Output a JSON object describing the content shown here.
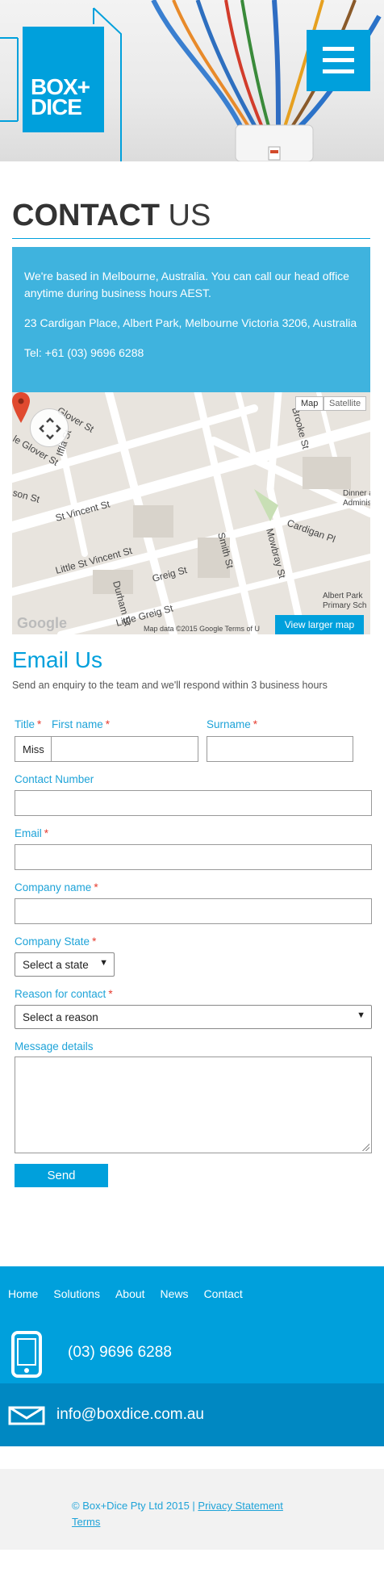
{
  "brand": {
    "logo_line1": "BOX+",
    "logo_line2": "DICE",
    "accent_color": "#00a0dc"
  },
  "header": {
    "menu_icon": "hamburger-icon"
  },
  "contact": {
    "title_bold": "CONTACT",
    "title_light": "US",
    "intro": "We're based in Melbourne, Australia. You can call our head office anytime during business hours AEST.",
    "address": "23 Cardigan Place, Albert Park, Melbourne Victoria 3206, Australia",
    "tel": "Tel: +61 (03) 9696 6288"
  },
  "map": {
    "toggle_map": "Map",
    "toggle_satellite": "Satellite",
    "larger_map": "View larger map",
    "attribution": "Map data ©2015 Google    Terms of U",
    "google_mark": "Google",
    "streets": [
      "Glover St",
      "Glover St",
      "Iffla St",
      "St Vincent St",
      "Little St Vincent St",
      "Durham St",
      "Greig St",
      "Little Greig St",
      "Smith St",
      "Mowbray St",
      "Brooke St",
      "Cardigan Pl",
      "Dinner a Administ",
      "Albert Park Primary Sch",
      "son St"
    ]
  },
  "form": {
    "title": "Email Us",
    "subtitle": "Send an enquiry to the team and we'll respond within 3 business hours",
    "required_mark": "*",
    "labels": {
      "title": "Title",
      "first_name": "First name",
      "surname": "Surname",
      "contact_number": "Contact Number",
      "email": "Email",
      "company_name": "Company name",
      "company_state": "Company State",
      "reason": "Reason for contact",
      "message": "Message details"
    },
    "values": {
      "title": "Miss",
      "first_name": "",
      "surname": "",
      "contact_number": "",
      "email": "",
      "company_name": "",
      "message": ""
    },
    "state_select": "Select a state",
    "reason_select": "Select a reason",
    "send": "Send"
  },
  "footer": {
    "nav": [
      "Home",
      "Solutions",
      "About",
      "News",
      "Contact"
    ],
    "phone": "(03) 9696 6288",
    "phone_icon": "mobile-phone-icon",
    "email": "info@boxdice.com.au",
    "email_icon": "envelope-icon",
    "copyright": "© Box+Dice Pty Ltd 2015 | ",
    "privacy": "Privacy Statement",
    "terms": "Terms"
  }
}
